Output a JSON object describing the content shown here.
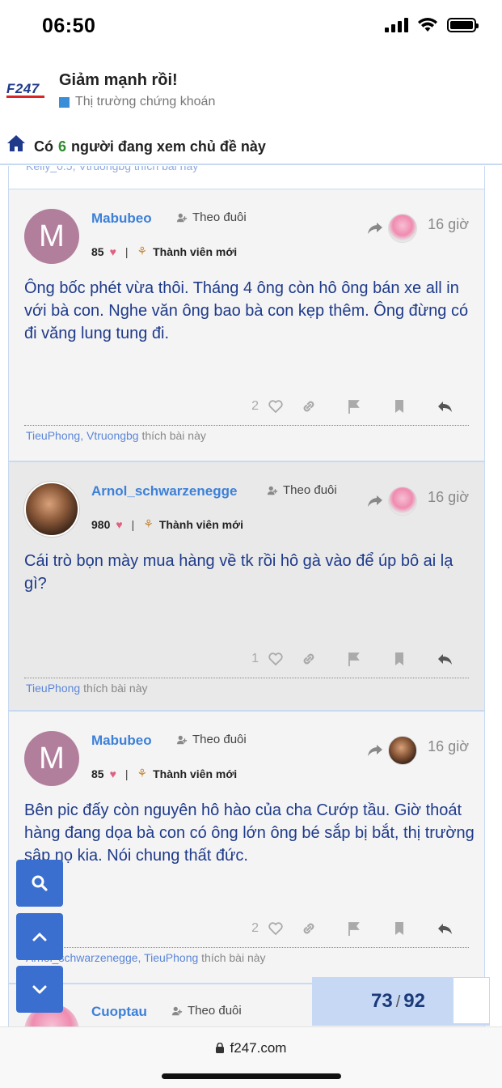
{
  "status_bar": {
    "time": "06:50"
  },
  "header": {
    "logo_text": "F247",
    "title": "Giảm mạnh rồi!",
    "category": "Thị trường chứng khoán",
    "category_color": "#3a8ed8"
  },
  "viewers": {
    "prefix": "Có",
    "count": "6",
    "suffix": "người đang xem chủ đề này"
  },
  "prev_likes": "Kelly_0.5, Vtruongbg thích bài này",
  "follow_label": "Theo đuôi",
  "rank_label": "Thành viên mới",
  "posts": [
    {
      "avatar_letter": "M",
      "username": "Mabubeo",
      "likes_received": "85",
      "time": "16 giờ",
      "content": "Ông bốc phét vừa thôi. Tháng 4 ông còn hô ông bán xe all in với bà con. Nghe văn ông bao bà con kẹp thêm. Ông đừng có đi văng lung tung đi.",
      "like_count": "2",
      "liked_by": [
        "TieuPhong",
        "Vtruongbg"
      ],
      "liked_suffix": "thích bài này"
    },
    {
      "avatar_letter": "",
      "username": "Arnol_schwarzenegge",
      "likes_received": "980",
      "time": "16 giờ",
      "content": "Cái trò bọn mày mua hàng về tk rồi hô gà vào để úp bô ai lạ gì?",
      "like_count": "1",
      "liked_by": [
        "TieuPhong"
      ],
      "liked_suffix": "thích bài này"
    },
    {
      "avatar_letter": "M",
      "username": "Mabubeo",
      "likes_received": "85",
      "time": "16 giờ",
      "content": "Bên pic đấy còn nguyên hô hào của cha Cướp tầu. Giờ thoát hàng đang dọa bà con có ông lớn ông bé sắp bị bắt, thị trường sập nọ kia. Nói chung thất đức.",
      "like_count": "2",
      "liked_by": [
        "Arnol_schwarzenegge",
        "TieuPhong"
      ],
      "liked_suffix": "thích bài này"
    },
    {
      "username": "Cuoptau"
    }
  ],
  "pager": {
    "current": "73",
    "total": "92"
  },
  "urlbar": {
    "url": "f247.com"
  },
  "colors": {
    "accent": "#3a6fd0",
    "username": "#3c80d8",
    "content": "#1e3a8a"
  }
}
